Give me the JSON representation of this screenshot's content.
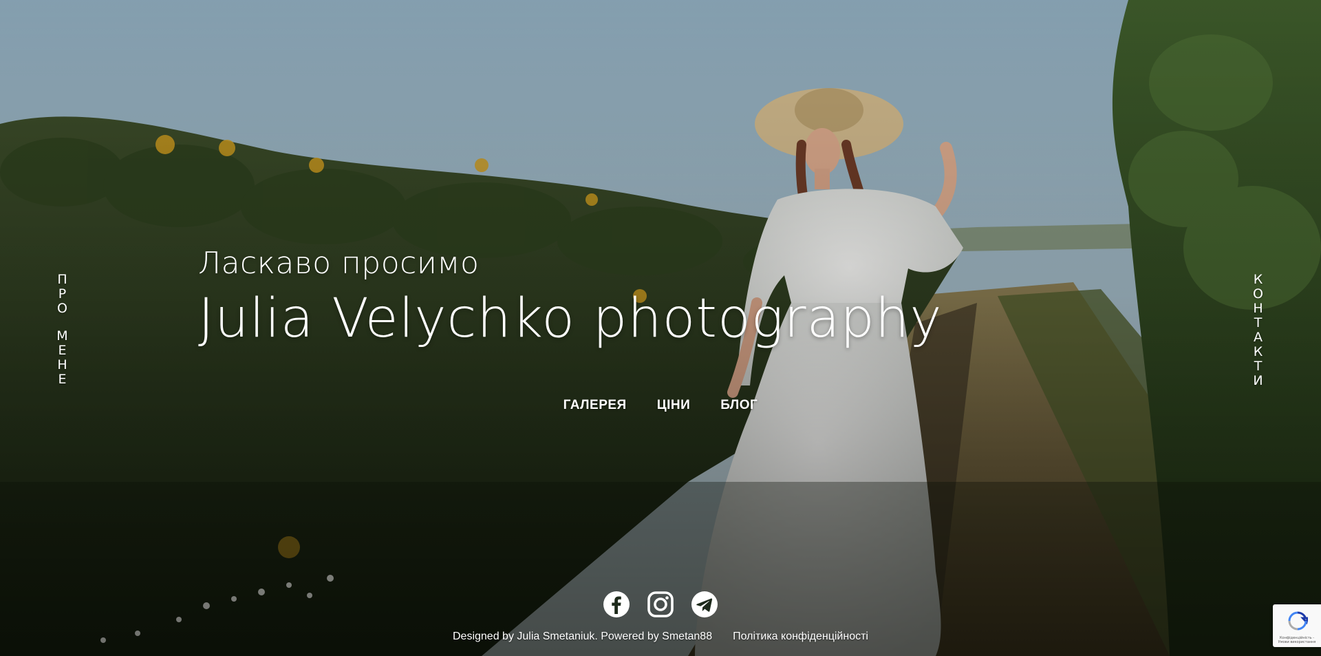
{
  "side_nav": {
    "left": {
      "label": "ПРО МЕНЕ",
      "words": [
        "ПРО",
        "МЕНЕ"
      ]
    },
    "right": {
      "label": "КОНТАКТИ",
      "words": [
        "КОНТАКТИ"
      ]
    }
  },
  "hero": {
    "welcome": "Ласкаво просимо",
    "brand": "Julia Velychko photography"
  },
  "main_nav": {
    "items": [
      {
        "label": "ГАЛЕРЕЯ"
      },
      {
        "label": "ЦІНИ"
      },
      {
        "label": "БЛОГ"
      }
    ]
  },
  "social": {
    "icons": [
      "facebook-icon",
      "instagram-icon",
      "telegram-icon"
    ]
  },
  "footer": {
    "credits": "Designed by Julia Smetaniuk. Powered by Smetan88",
    "privacy": "Політика конфіденційності"
  },
  "recaptcha": {
    "icon": "recaptcha-icon",
    "fine_print": "Конфіденційність - Умови використання"
  },
  "colors": {
    "text": "#ffffff",
    "sky": "#9fb7c6",
    "foliage": "#2c3d22",
    "path": "#7a6a4a"
  }
}
